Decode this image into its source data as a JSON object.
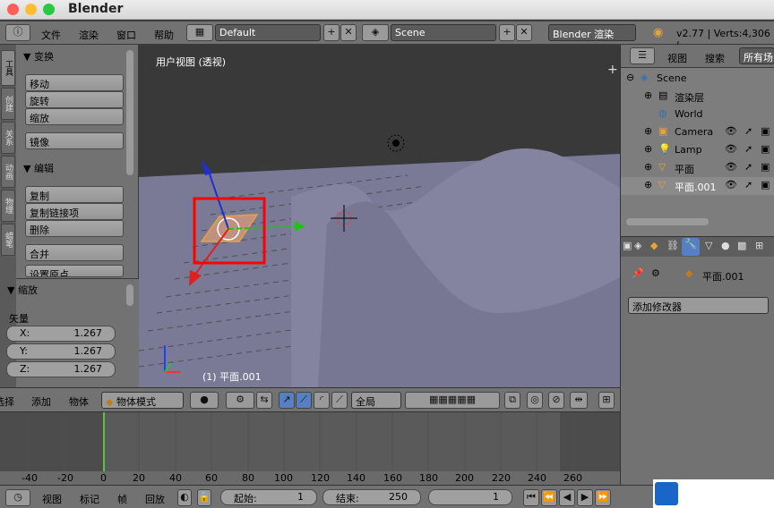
{
  "window": {
    "app_title": "Blender"
  },
  "infobar": {
    "menus": [
      "文件",
      "渲染",
      "窗口",
      "帮助"
    ],
    "layout": "Default",
    "scene": "Scene",
    "engine": "Blender 渲染",
    "stats": "v2.77 | Verts:4,306 |"
  },
  "left_tabs": [
    "工具",
    "创建",
    "关系",
    "动画",
    "物理",
    "蜡笔"
  ],
  "toolshelf": {
    "transform_title": "变换",
    "transform_buttons": [
      "移动",
      "旋转",
      "缩放",
      "镜像"
    ],
    "edit_title": "编辑",
    "edit_buttons": [
      "复制",
      "复制链接项",
      "删除",
      "合并",
      "设置原点"
    ],
    "resize_title": "缩放",
    "vector_label": "矢量",
    "vector": [
      {
        "axis": "X:",
        "value": "1.267"
      },
      {
        "axis": "Y:",
        "value": "1.267"
      },
      {
        "axis": "Z:",
        "value": "1.267"
      }
    ]
  },
  "viewport": {
    "view_label": "用户视图 (透视)",
    "object_label": "(1) 平面.001"
  },
  "view_header": {
    "items": [
      "选择",
      "添加",
      "物体"
    ],
    "mode": "物体模式",
    "pivot": "全局"
  },
  "timeline": {
    "ruler": [
      "-40",
      "-20",
      "0",
      "20",
      "40",
      "60",
      "80",
      "100",
      "120",
      "140",
      "160",
      "180",
      "200",
      "220",
      "240",
      "260"
    ]
  },
  "footer": {
    "items": [
      "视图",
      "标记",
      "帧",
      "回放"
    ],
    "start_label": "起始:",
    "start_value": "1",
    "end_label": "结束:",
    "end_value": "250",
    "current_frame": "1"
  },
  "outliner": {
    "header": [
      "视图",
      "搜索",
      "所有场"
    ],
    "rows": [
      {
        "name": "Scene"
      },
      {
        "name": "渲染层"
      },
      {
        "name": "World"
      },
      {
        "name": "Camera"
      },
      {
        "name": "Lamp"
      },
      {
        "name": "平面"
      },
      {
        "name": "平面.001"
      }
    ]
  },
  "properties": {
    "object_name": "平面.001",
    "add_modifier": "添加修改器"
  },
  "colors": {
    "accent_orange": "#e9a33b",
    "selection_red": "#ff0000",
    "timeline_cursor": "#60c040"
  }
}
